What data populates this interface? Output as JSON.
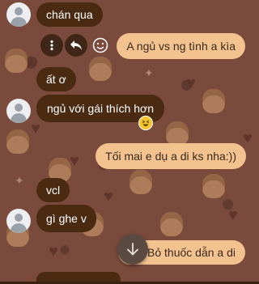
{
  "messages": [
    {
      "id": "m1",
      "direction": "incoming",
      "text": "chán qua",
      "has_avatar": true
    },
    {
      "id": "m2",
      "direction": "outgoing",
      "text": "A ngủ vs ng tình a kìa"
    },
    {
      "id": "m3",
      "direction": "incoming",
      "text": "ất ơ",
      "has_avatar": false
    },
    {
      "id": "m4",
      "direction": "incoming",
      "text": "ngủ với gái thích hơn",
      "has_avatar": true,
      "reaction": "grinning-squint-face"
    },
    {
      "id": "m5",
      "direction": "outgoing",
      "text": "Tối mai e dụ a di ks nha:))"
    },
    {
      "id": "m6",
      "direction": "incoming",
      "text": "vcl",
      "has_avatar": false
    },
    {
      "id": "m7",
      "direction": "incoming",
      "text": "gì ghe v",
      "has_avatar": true
    },
    {
      "id": "m8",
      "direction": "outgoing",
      "text": "Bỏ thuốc dẫn a di"
    }
  ],
  "message_actions": {
    "icons": [
      "more-options-icon",
      "reply-icon",
      "react-icon"
    ]
  },
  "scroll_to_bottom": {
    "icon": "arrow-down-icon"
  },
  "colors": {
    "background": "#7a4a3c",
    "incoming_bubble": "#4a2a10",
    "outgoing_bubble": "#f3c28f",
    "incoming_text": "#ffffff",
    "outgoing_text": "#3a2a1c"
  }
}
